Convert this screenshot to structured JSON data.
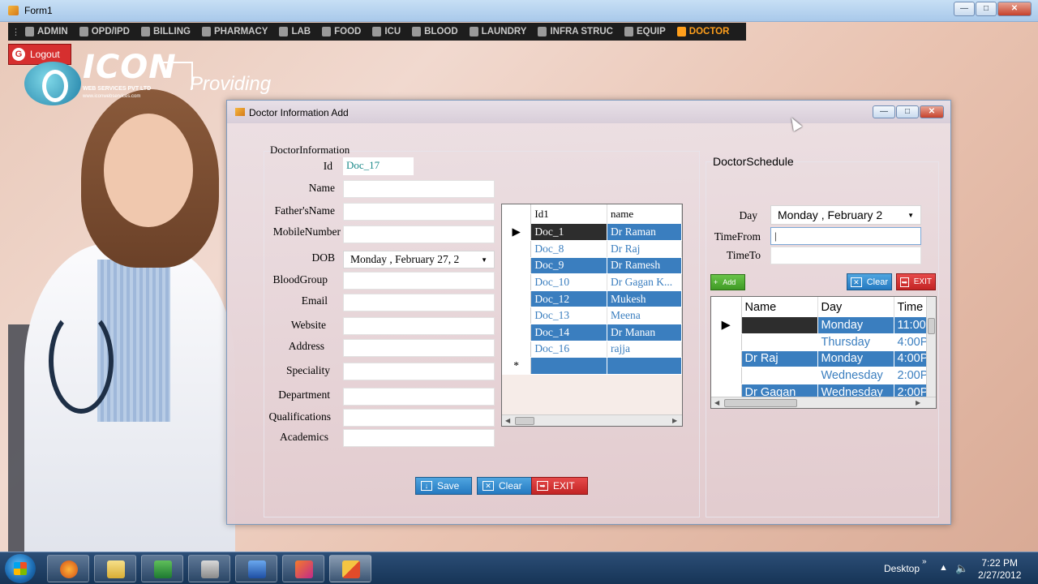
{
  "main_window": {
    "title": "Form1"
  },
  "menu": [
    {
      "label": "ADMIN",
      "active": false
    },
    {
      "label": "OPD/IPD",
      "active": false
    },
    {
      "label": "BILLING",
      "active": false
    },
    {
      "label": "PHARMACY",
      "active": false
    },
    {
      "label": "LAB",
      "active": false
    },
    {
      "label": "FOOD",
      "active": false
    },
    {
      "label": "ICU",
      "active": false
    },
    {
      "label": "BLOOD",
      "active": false
    },
    {
      "label": "LAUNDRY",
      "active": false
    },
    {
      "label": "INFRA STRUC",
      "active": false
    },
    {
      "label": "EQUIP",
      "active": false
    },
    {
      "label": "DOCTOR",
      "active": true
    }
  ],
  "logout_label": "Logout",
  "logo": {
    "brand": "ICON",
    "sub": "WEB SERVICES PVT LTD",
    "sub2": "www.iconwebservices.com",
    "tagline": "Providing"
  },
  "dialog": {
    "title": "Doctor Information Add",
    "doctor_info": {
      "group_title": "DoctorInformation",
      "labels": {
        "id": "Id",
        "name": "Name",
        "father": "Father'sName",
        "mobile": "MobileNumber",
        "dob": "DOB",
        "blood": "BloodGroup",
        "email": "Email",
        "website": "Website",
        "address": "Address",
        "speciality": "Speciality",
        "department": "Department",
        "qualifications": "Qualifications",
        "academics": "Academics"
      },
      "values": {
        "id": "Doc_17",
        "dob": "Monday  ,  February  27, 2"
      }
    },
    "doctor_grid": {
      "columns": [
        "Id1",
        "name"
      ],
      "rows": [
        {
          "id": "Doc_1",
          "name": "Dr Raman"
        },
        {
          "id": "Doc_8",
          "name": "Dr Raj"
        },
        {
          "id": "Doc_9",
          "name": "Dr Ramesh"
        },
        {
          "id": "Doc_10",
          "name": "Dr Gagan K..."
        },
        {
          "id": "Doc_12",
          "name": "Mukesh"
        },
        {
          "id": "Doc_13",
          "name": "Meena"
        },
        {
          "id": "Doc_14",
          "name": "Dr Manan"
        },
        {
          "id": "Doc_16",
          "name": "rajja"
        }
      ],
      "new_row_marker": "*",
      "current_row_marker": "▶"
    },
    "schedule": {
      "group_title": "DoctorSchedule",
      "labels": {
        "day": "Day",
        "time_from": "TimeFrom",
        "time_to": "TimeTo"
      },
      "values": {
        "day": "Monday  ,  February  2"
      },
      "buttons": {
        "add": "Add",
        "clear": "Clear",
        "exit": "EXIT"
      },
      "grid": {
        "columns": [
          "Name",
          "Day",
          "Time"
        ],
        "rows": [
          {
            "name": "",
            "day": "Monday",
            "time": "11:00"
          },
          {
            "name": "",
            "day": "Thursday",
            "time": "4:00P"
          },
          {
            "name": "Dr Raj",
            "day": "Monday",
            "time": "4:00P"
          },
          {
            "name": "",
            "day": "Wednesday",
            "time": "2:00P"
          },
          {
            "name": "Dr Gagan",
            "day": "Wednesday",
            "time": "2:00P"
          }
        ]
      }
    },
    "buttons": {
      "save": "Save",
      "clear": "Clear",
      "exit": "EXIT"
    }
  },
  "taskbar": {
    "desktop_label": "Desktop",
    "time": "7:22 PM",
    "date": "2/27/2012",
    "apps": [
      "firefox",
      "explorer",
      "excel",
      "tools",
      "word",
      "app",
      "form"
    ]
  },
  "colors": {
    "grid_blue": "#3a7ebf",
    "menu_active": "#ff9f1c",
    "logout_red": "#d62f2f"
  }
}
